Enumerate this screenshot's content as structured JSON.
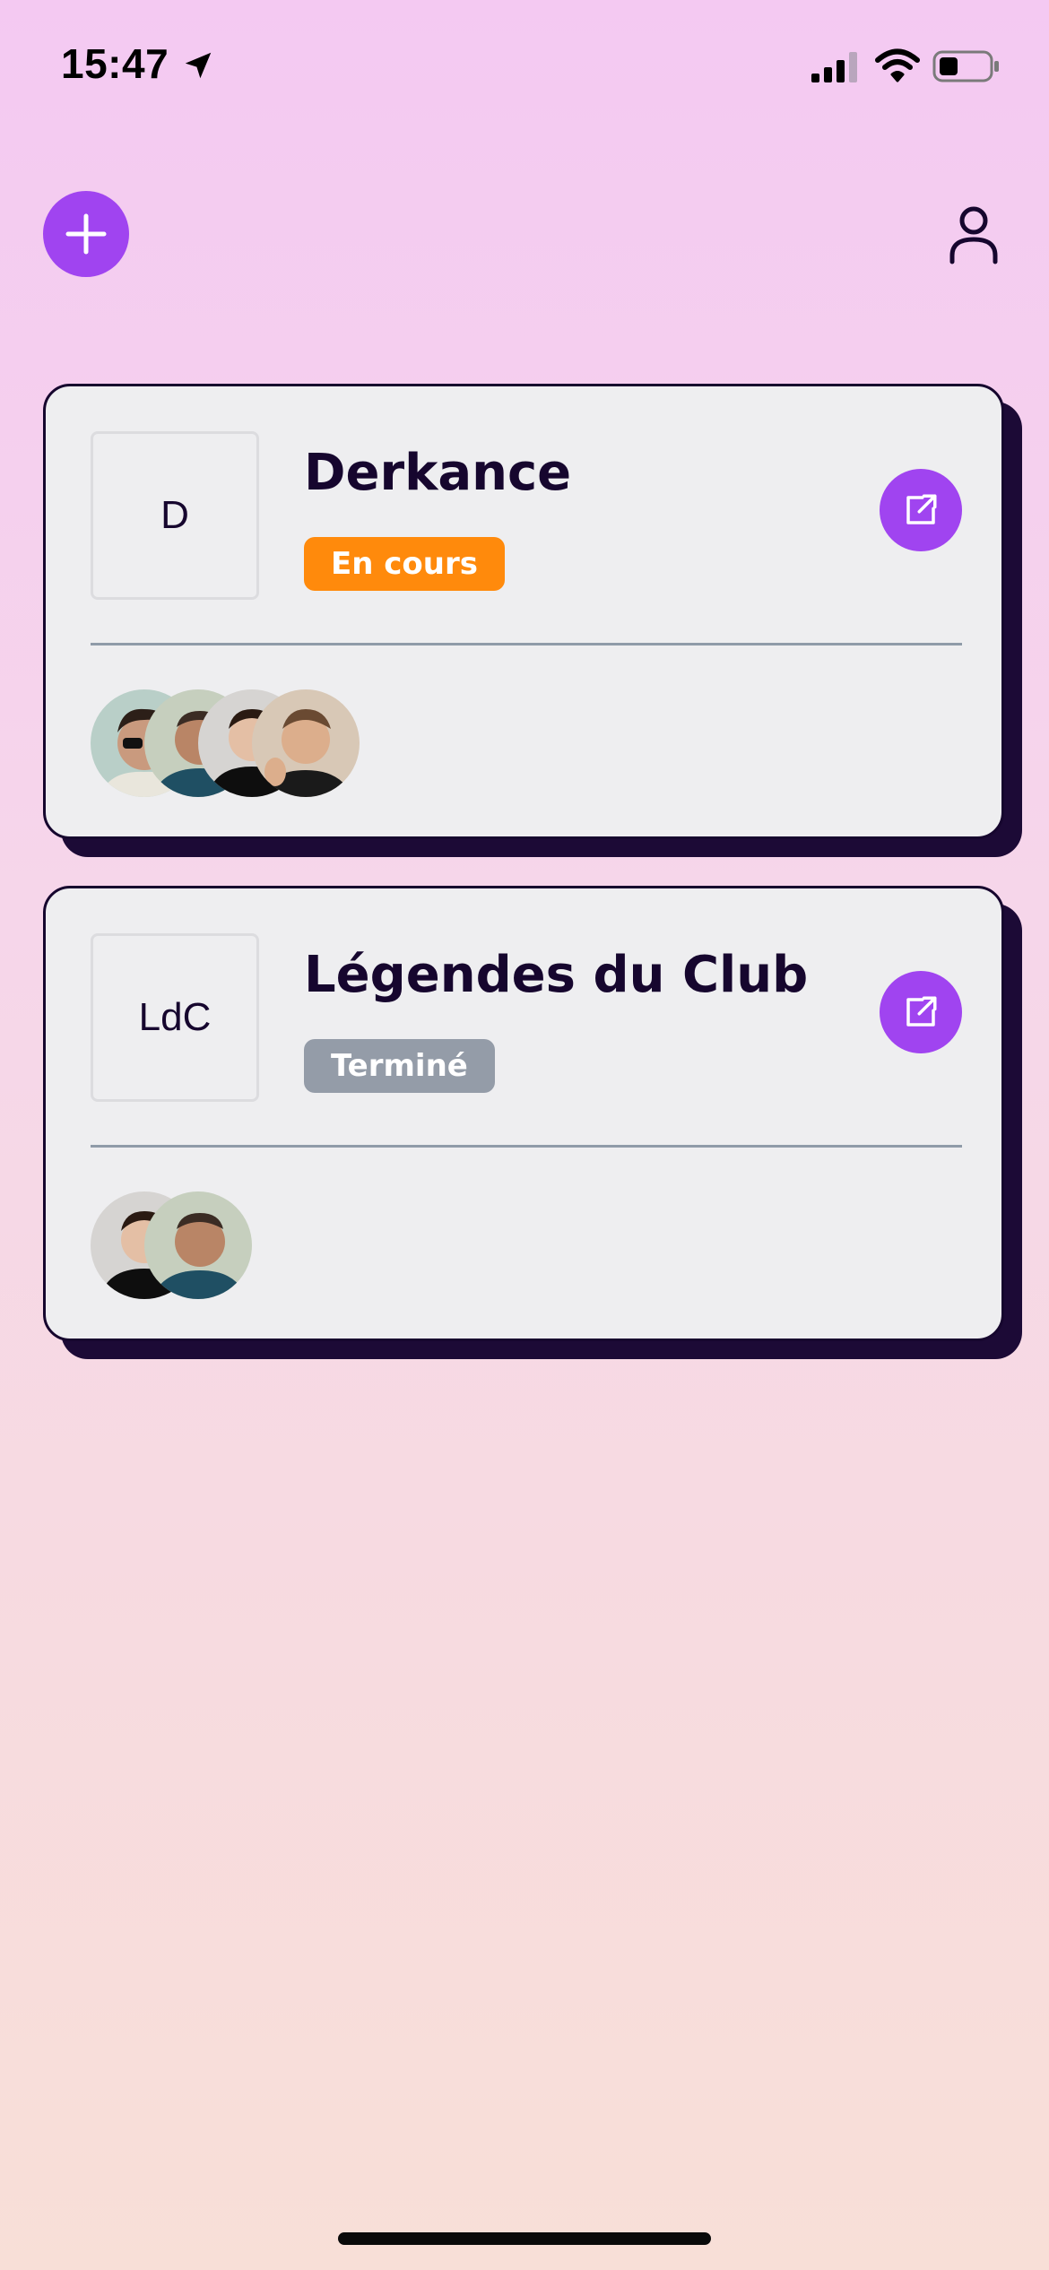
{
  "status_bar": {
    "time": "15:47"
  },
  "header": {
    "add_icon": "plus-icon",
    "profile_icon": "user-icon"
  },
  "leagues": [
    {
      "thumb_text": "D",
      "title": "Derkance",
      "status_label": "En cours",
      "status_color": "#ff8a0c",
      "members": 4
    },
    {
      "thumb_text": "LdC",
      "title": "Légendes du Club",
      "status_label": "Terminé",
      "status_color": "#949ca8",
      "members": 2
    }
  ],
  "colors": {
    "accent": "#a044f0",
    "dark": "#16062e",
    "card_bg": "#eeeef0"
  }
}
